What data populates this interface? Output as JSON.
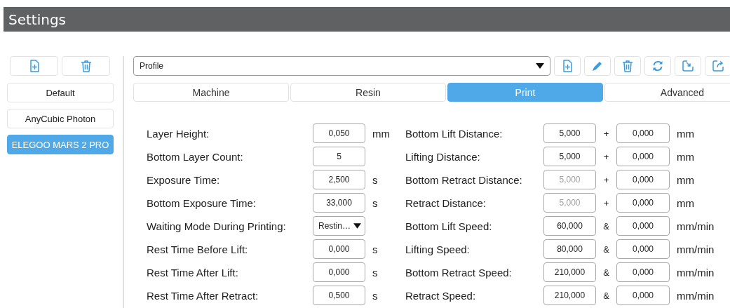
{
  "window": {
    "title": "Settings"
  },
  "profiles": [
    {
      "label": "Default",
      "selected": false
    },
    {
      "label": "AnyCubic Photon",
      "selected": false
    },
    {
      "label": "ELEGOO MARS 2 PRO",
      "selected": true
    }
  ],
  "profile_select": {
    "value": "Profile"
  },
  "tabs": [
    {
      "label": "Machine",
      "selected": false
    },
    {
      "label": "Resin",
      "selected": false
    },
    {
      "label": "Print",
      "selected": true
    },
    {
      "label": "Advanced",
      "selected": false
    }
  ],
  "left_fields": [
    {
      "label": "Layer Height:",
      "kind": "input",
      "value": "0,050",
      "unit": "mm"
    },
    {
      "label": "Bottom Layer Count:",
      "kind": "input",
      "value": "5"
    },
    {
      "label": "Exposure Time:",
      "kind": "input",
      "value": "2,500",
      "unit": "s"
    },
    {
      "label": "Bottom Exposure Time:",
      "kind": "input",
      "value": "33,000",
      "unit": "s"
    },
    {
      "label": "Waiting Mode During Printing:",
      "kind": "dropdown",
      "value": "Restin…"
    },
    {
      "label": "Rest Time Before Lift:",
      "kind": "input",
      "value": "0,000",
      "unit": "s"
    },
    {
      "label": "Rest Time After Lift:",
      "kind": "input",
      "value": "0,000",
      "unit": "s"
    },
    {
      "label": "Rest Time After Retract:",
      "kind": "input",
      "value": "0,500",
      "unit": "s"
    }
  ],
  "right_fields": [
    {
      "label": "Bottom Lift Distance:",
      "value": "5,000",
      "disabled": false,
      "operator": "+",
      "value_2": "0,000",
      "unit": "mm"
    },
    {
      "label": "Lifting Distance:",
      "value": "5,000",
      "disabled": false,
      "operator": "+",
      "value_2": "0,000",
      "unit": "mm"
    },
    {
      "label": "Bottom Retract Distance:",
      "value": "5,000",
      "disabled": true,
      "operator": "+",
      "value_2": "0,000",
      "unit": "mm"
    },
    {
      "label": "Retract Distance:",
      "value": "5,000",
      "disabled": true,
      "operator": "+",
      "value_2": "0,000",
      "unit": "mm"
    },
    {
      "label": "Bottom Lift Speed:",
      "value": "60,000",
      "disabled": false,
      "operator": "&",
      "value_2": "0,000",
      "unit": "mm/min"
    },
    {
      "label": "Lifting Speed:",
      "value": "80,000",
      "disabled": false,
      "operator": "&",
      "value_2": "0,000",
      "unit": "mm/min"
    },
    {
      "label": "Bottom Retract Speed:",
      "value": "210,000",
      "disabled": false,
      "operator": "&",
      "value_2": "0,000",
      "unit": "mm/min"
    },
    {
      "label": "Retract Speed:",
      "value": "210,000",
      "disabled": false,
      "operator": "&",
      "value_2": "0,000",
      "unit": "mm/min"
    }
  ]
}
